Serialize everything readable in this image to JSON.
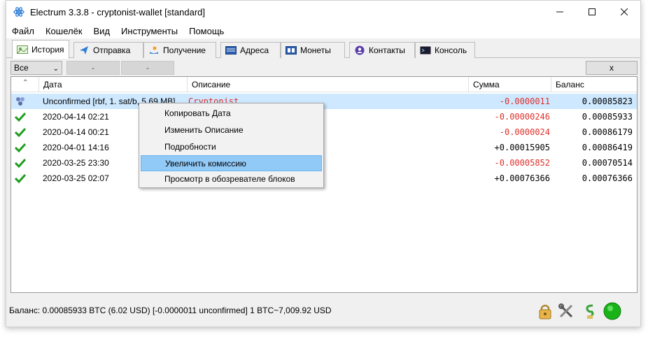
{
  "window": {
    "title": "Electrum 3.3.8  -  cryptonist-wallet  [standard]"
  },
  "menu": [
    "Файл",
    "Кошелёк",
    "Вид",
    "Инструменты",
    "Помощь"
  ],
  "tabs": [
    "История",
    "Отправка",
    "Получение",
    "Адреса",
    "Монеты",
    "Контакты",
    "Консоль"
  ],
  "filter": {
    "select_value": "Все",
    "btn1": "-",
    "btn2": "-",
    "clear": "x"
  },
  "columns": {
    "date": "Дата",
    "description": "Описание",
    "amount": "Сумма",
    "balance": "Баланс"
  },
  "rows": [
    {
      "date": "Unconfirmed [rbf, 1. sat/b, 5.69 MB]",
      "description": "Cryptonist",
      "amount": "-0.0000011",
      "balance": "0.00085823"
    },
    {
      "date": "2020-04-14 02:21",
      "description": "",
      "amount": "-0.00000246",
      "balance": "0.00085933"
    },
    {
      "date": "2020-04-14 00:21",
      "description": "",
      "amount": "-0.0000024",
      "balance": "0.00086179"
    },
    {
      "date": "2020-04-01 14:16",
      "description": "",
      "amount": "+0.00015905",
      "balance": "0.00086419"
    },
    {
      "date": "2020-03-25 23:30",
      "description": "",
      "amount": "-0.00005852",
      "balance": "0.00070514"
    },
    {
      "date": "2020-03-25 02:07",
      "description": "",
      "amount": "+0.00076366",
      "balance": "0.00076366"
    }
  ],
  "context_menu": [
    "Копировать Дата",
    "Изменить Описание",
    "Подробности",
    "Увеличить комиссию",
    "Просмотр в обозревателе блоков"
  ],
  "status": {
    "text": "Баланс: 0.00085933 BTC (6.02 USD)  [-0.0000011 unconfirmed]  1 BTC~7,009.92 USD"
  },
  "colors": {
    "negative": "#e0302a",
    "selected_row": "#cde8ff",
    "menu_highlight": "#91c9f7",
    "online": "#19b319"
  }
}
